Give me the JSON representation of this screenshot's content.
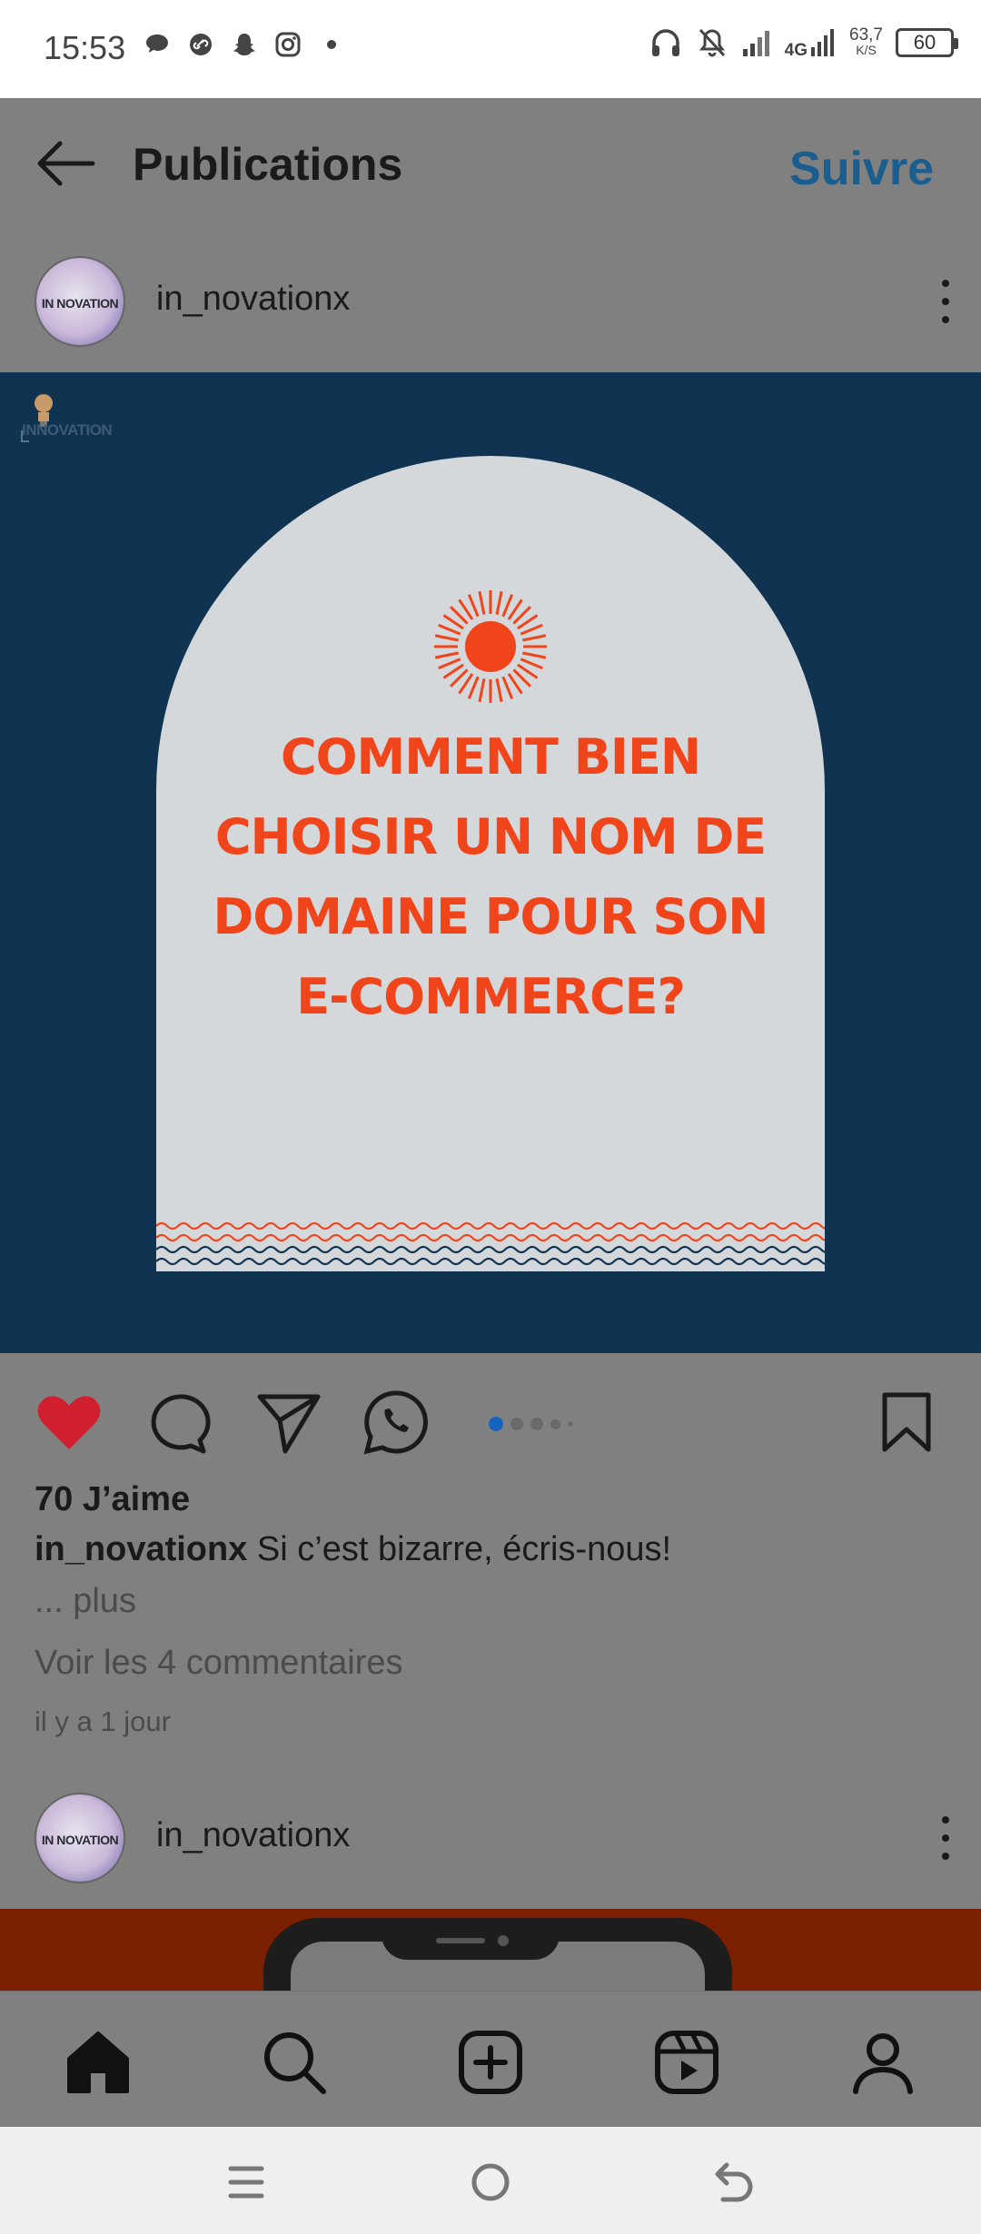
{
  "status_bar": {
    "time": "15:53",
    "network": "4G",
    "speed_value": "63,7",
    "speed_unit": "K/S",
    "battery": "60",
    "left_icons": [
      "message-icon",
      "link-icon",
      "snapchat-icon",
      "instagram-icon",
      "dot-icon"
    ],
    "right_icons": [
      "headphones-icon",
      "mute-bell-icon",
      "signal-icon",
      "signal-4g-icon",
      "battery-icon"
    ]
  },
  "header": {
    "title": "Publications",
    "follow_label": "Suivre",
    "follow_color": "#1a5d8f"
  },
  "post": {
    "username": "in_novationx",
    "avatar_text": "IN NOVATION",
    "logo_text": "INNOVATION",
    "image_lines": [
      "COMMENT BIEN",
      "CHOISIR UN NOM DE",
      "DOMAINE POUR SON",
      "E-COMMERCE?"
    ],
    "colors": {
      "background": "#0f3350",
      "arch": "#d5d8db",
      "accent": "#f0441b",
      "like": "#d01f2e"
    },
    "carousel": {
      "total": 5,
      "active": 1
    },
    "likes": "70 J’aime",
    "caption_user": "in_novationx",
    "caption_text": " Si c’est bizarre, écris-nous!",
    "more": "... plus",
    "comments": "Voir les 4 commentaires",
    "time_ago": "il y a 1 jour"
  },
  "post2": {
    "username": "in_novationx",
    "avatar_text": "IN NOVATION"
  },
  "bottom_nav": {
    "items": [
      "home-icon",
      "search-icon",
      "create-post-icon",
      "reels-icon",
      "profile-icon"
    ]
  },
  "system_nav": {
    "items": [
      "menu-icon",
      "home-circle-icon",
      "back-icon"
    ]
  }
}
